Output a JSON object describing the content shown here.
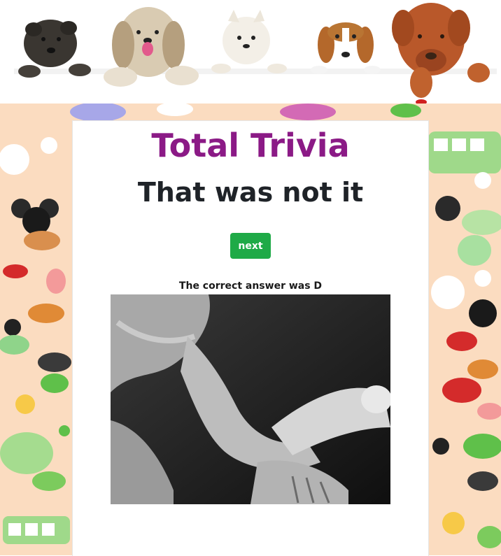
{
  "header": {
    "banner_alt": "dog banner",
    "dogs": [
      "terrier-dog",
      "bearded-collie-dog",
      "westie-dog",
      "beagle-dog",
      "ridgeback-dog"
    ]
  },
  "card": {
    "site_title": "Total Trivia",
    "result_title": "That was not it",
    "next_button_label": "next",
    "answer_text": "The correct answer was D"
  },
  "colors": {
    "title": "#8b1a86",
    "button": "#1faa47",
    "pattern_bg": "#fbdcc0"
  }
}
